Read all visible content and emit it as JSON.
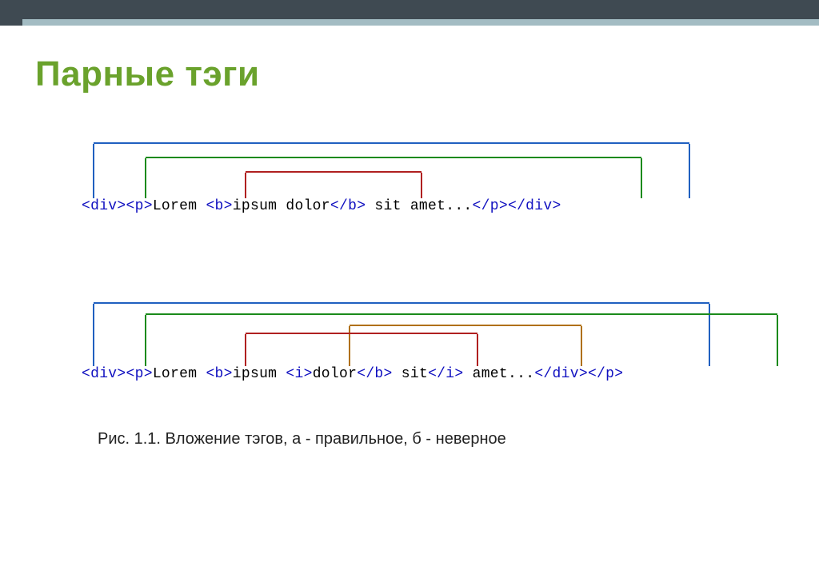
{
  "title": "Парные тэги",
  "example1": {
    "tokens": {
      "div_open": "<div>",
      "p_open": "<p>",
      "t1": "Lorem ",
      "b_open": "<b>",
      "t2": "ipsum dolor",
      "b_close": "</b>",
      "t3": " sit amet...",
      "p_close": "</p>",
      "div_close": "</div>"
    }
  },
  "example2": {
    "tokens": {
      "div_open": "<div>",
      "p_open": "<p>",
      "t1": "Lorem ",
      "b_open": "<b>",
      "t2": "ipsum ",
      "i_open": "<i>",
      "t3": "dolor",
      "b_close": "</b>",
      "t4": " sit",
      "i_close": "</i>",
      "t5": " amet...",
      "div_close": "</div>",
      "p_close": "</p>"
    }
  },
  "caption": "Рис. 1.1. Вложение тэгов, а - правильное, б - неверное"
}
